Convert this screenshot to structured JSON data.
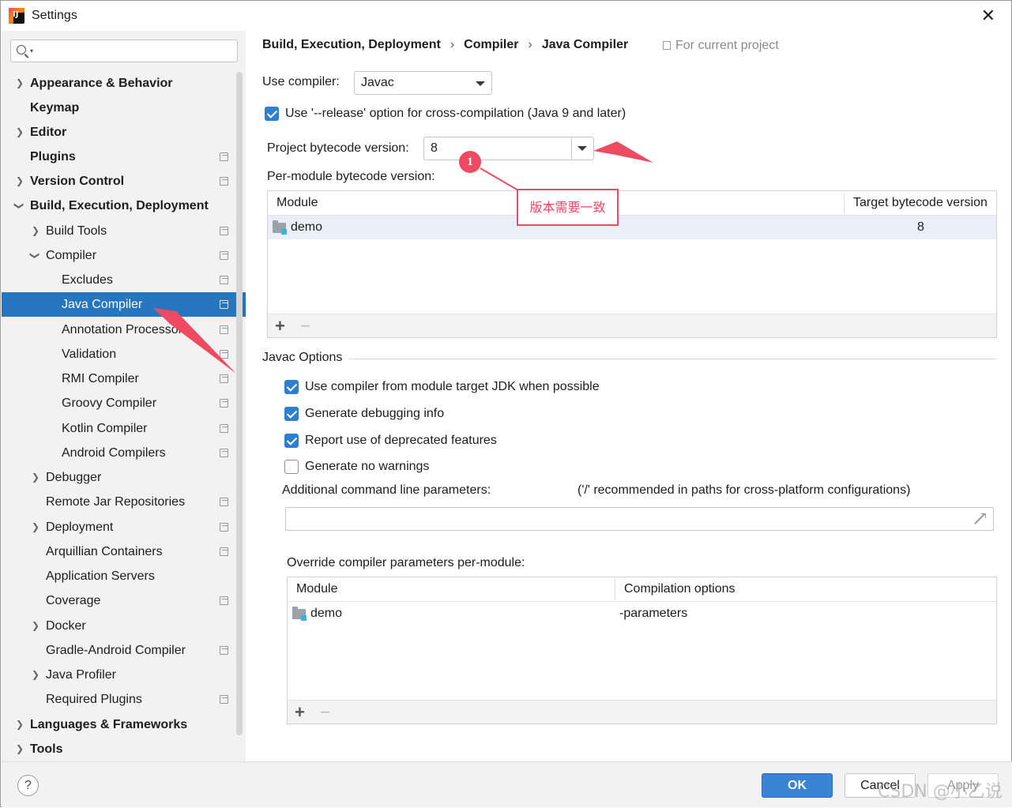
{
  "window": {
    "title": "Settings"
  },
  "sidebar": {
    "search_placeholder": "",
    "items": [
      {
        "label": "Appearance & Behavior"
      },
      {
        "label": "Keymap"
      },
      {
        "label": "Editor"
      },
      {
        "label": "Plugins"
      },
      {
        "label": "Version Control"
      },
      {
        "label": "Build, Execution, Deployment"
      },
      {
        "label": "Build Tools"
      },
      {
        "label": "Compiler"
      },
      {
        "label": "Excludes"
      },
      {
        "label": "Java Compiler"
      },
      {
        "label": "Annotation Processors"
      },
      {
        "label": "Validation"
      },
      {
        "label": "RMI Compiler"
      },
      {
        "label": "Groovy Compiler"
      },
      {
        "label": "Kotlin Compiler"
      },
      {
        "label": "Android Compilers"
      },
      {
        "label": "Debugger"
      },
      {
        "label": "Remote Jar Repositories"
      },
      {
        "label": "Deployment"
      },
      {
        "label": "Arquillian Containers"
      },
      {
        "label": "Application Servers"
      },
      {
        "label": "Coverage"
      },
      {
        "label": "Docker"
      },
      {
        "label": "Gradle-Android Compiler"
      },
      {
        "label": "Java Profiler"
      },
      {
        "label": "Required Plugins"
      },
      {
        "label": "Languages & Frameworks"
      },
      {
        "label": "Tools"
      }
    ],
    "selected": "Java Compiler"
  },
  "breadcrumb": [
    "Build, Execution, Deployment",
    "Compiler",
    "Java Compiler"
  ],
  "for_current_project": "For current project",
  "use_compiler": {
    "label": "Use compiler:",
    "value": "Javac"
  },
  "release_option": {
    "label": "Use '--release' option for cross-compilation (Java 9 and later)",
    "checked": true
  },
  "project_bytecode": {
    "label": "Project bytecode version:",
    "value": "8"
  },
  "per_module": {
    "label": "Per-module bytecode version:",
    "columns": [
      "Module",
      "Target bytecode version"
    ],
    "rows": [
      {
        "module": "demo",
        "target": "8"
      }
    ]
  },
  "javac_options": {
    "title": "Javac Options",
    "checkboxes": [
      {
        "label": "Use compiler from module target JDK when possible",
        "checked": true
      },
      {
        "label": "Generate debugging info",
        "checked": true
      },
      {
        "label": "Report use of deprecated features",
        "checked": true
      },
      {
        "label": "Generate no warnings",
        "checked": false
      }
    ],
    "additional_label": "Additional command line parameters:",
    "additional_hint": "('/' recommended in paths for cross-platform configurations)",
    "additional_value": ""
  },
  "override": {
    "label": "Override compiler parameters per-module:",
    "columns": [
      "Module",
      "Compilation options"
    ],
    "rows": [
      {
        "module": "demo",
        "options": "-parameters"
      }
    ]
  },
  "toolbar": {
    "add": "+",
    "remove": "−"
  },
  "footer": {
    "help": "?",
    "ok": "OK",
    "cancel": "Cancel",
    "apply": "Apply"
  },
  "annotation": {
    "badge": "1",
    "note": "版本需要一致",
    "color": "#ee4b63"
  },
  "watermark": "CSDN @小乙说",
  "colors": {
    "selection": "#2675bf",
    "ok_button": "#3a85d3",
    "checkbox": "#2f7fd1"
  }
}
